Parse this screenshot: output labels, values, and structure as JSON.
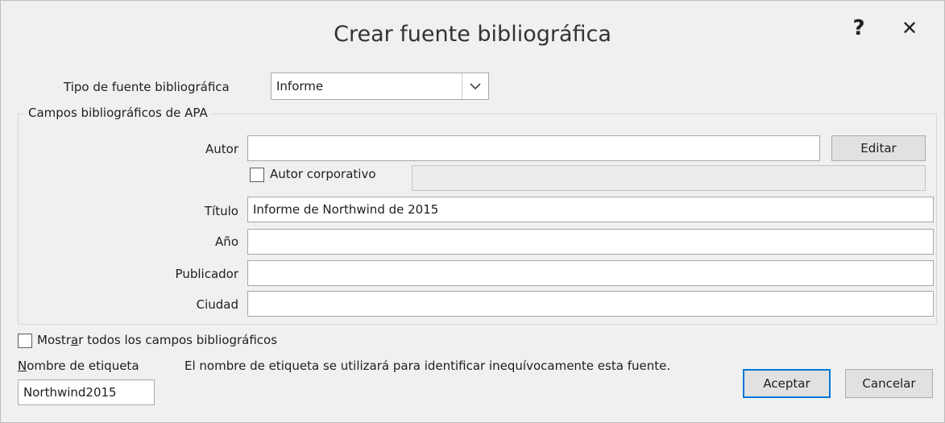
{
  "dialog": {
    "title": "Crear fuente bibliográfica",
    "help_label": "?",
    "close_label": "✕"
  },
  "source_type": {
    "label": "Tipo de fuente bibliográfica",
    "value": "Informe"
  },
  "group": {
    "legend": "Campos bibliográficos de APA"
  },
  "fields": {
    "author_label": "Autor",
    "author_value": "",
    "edit_button": "Editar",
    "corporate_author_label": "Autor corporativo",
    "corporate_author_checked": false,
    "corporate_author_value": "",
    "title_label": "Título",
    "title_value": "Informe de Northwind de 2015",
    "year_label": "Año",
    "year_value": "",
    "publisher_label": "Publicador",
    "publisher_value": "",
    "city_label": "Ciudad",
    "city_value": ""
  },
  "show_all": {
    "label_pre": "Mostr",
    "label_mnemonic": "a",
    "label_post": "r todos los campos bibliográficos",
    "checked": false
  },
  "tag": {
    "label_mnemonic": "N",
    "label_post": "ombre de etiqueta",
    "hint": "El nombre de etiqueta se utilizará para identificar inequívocamente esta fuente.",
    "value": "Northwind2015"
  },
  "buttons": {
    "ok": "Aceptar",
    "cancel": "Cancelar"
  },
  "colors": {
    "background": "#f0f0f0",
    "default_button_border": "#0078d7"
  }
}
